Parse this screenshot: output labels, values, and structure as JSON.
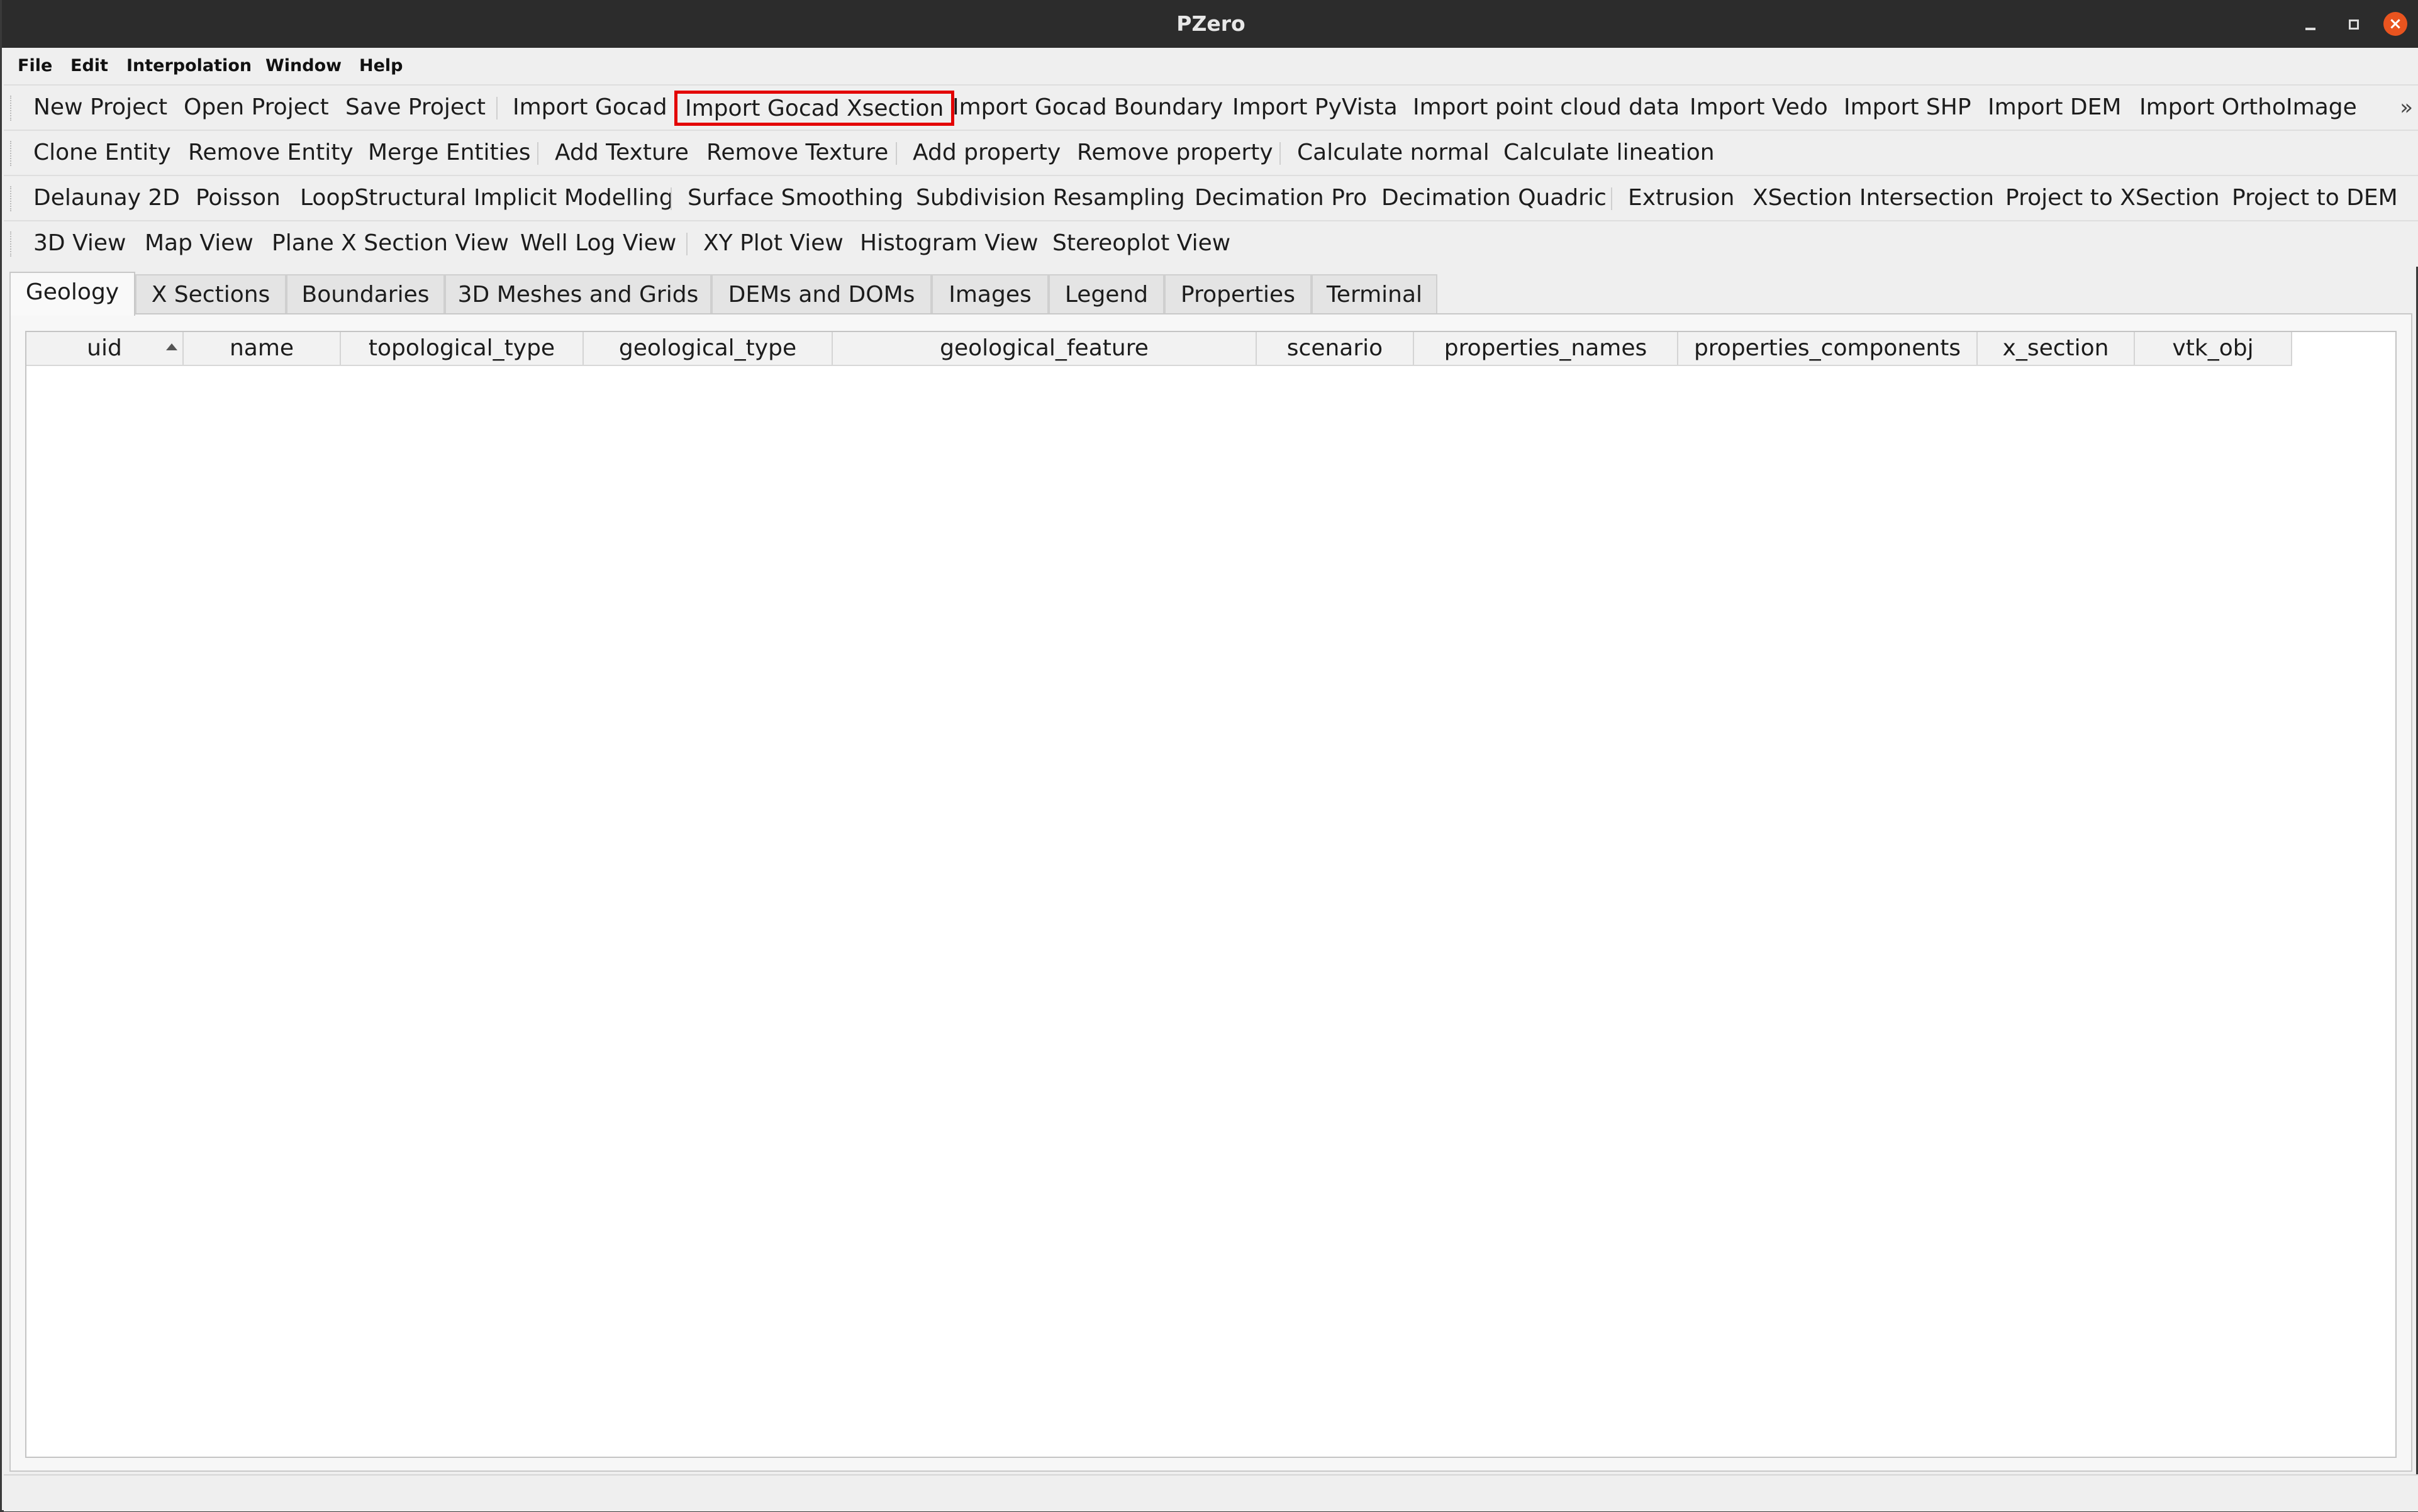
{
  "window": {
    "title": "PZero"
  },
  "menubar": [
    "File",
    "Edit",
    "Interpolation",
    "Window",
    "Help"
  ],
  "toolbars": {
    "project": [
      "New Project",
      "Open Project",
      "Save Project",
      "Import Gocad",
      "Import Gocad Xsection",
      "Import Gocad Boundary",
      "Import PyVista",
      "Import point cloud data",
      "Import Vedo",
      "Import SHP",
      "Import DEM",
      "Import OrthoImage"
    ],
    "more": "»",
    "edit": [
      "Clone Entity",
      "Remove Entity",
      "Merge Entities",
      "Add Texture",
      "Remove Texture",
      "Add property",
      "Remove property",
      "Calculate normal",
      "Calculate lineation"
    ],
    "processing": [
      "Delaunay 2D",
      "Poisson",
      "LoopStructural Implicit Modelling",
      "Surface Smoothing",
      "Subdivision Resampling",
      "Decimation Pro",
      "Decimation Quadric",
      "Extrusion",
      "XSection Intersection",
      "Project to XSection",
      "Project to DEM"
    ],
    "views": [
      "3D View",
      "Map View",
      "Plane X Section View",
      "Well Log View",
      "XY Plot View",
      "Histogram View",
      "Stereoplot View"
    ],
    "highlighted_item": "Import Gocad Xsection",
    "highlight_color": "#e30000"
  },
  "tabs": [
    "Geology",
    "X Sections",
    "Boundaries",
    "3D Meshes and Grids",
    "DEMs and DOMs",
    "Images",
    "Legend",
    "Properties",
    "Terminal"
  ],
  "active_tab": "Geology",
  "table": {
    "columns": [
      "uid",
      "name",
      "topological_type",
      "geological_type",
      "geological_feature",
      "scenario",
      "properties_names",
      "properties_components",
      "x_section",
      "vtk_obj"
    ],
    "sorted_column": "uid",
    "sort_order": "ascending",
    "rows": []
  }
}
